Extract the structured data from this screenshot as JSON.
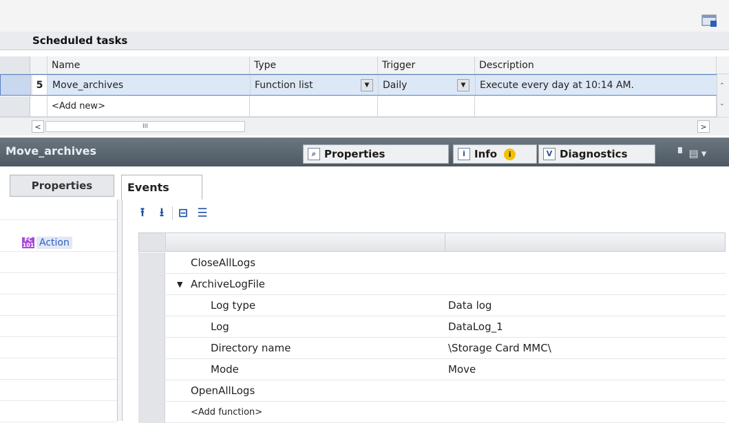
{
  "scheduled": {
    "title": "Scheduled tasks",
    "columns": [
      "Name",
      "Type",
      "Trigger",
      "Description"
    ],
    "task": {
      "number": "5",
      "name": "Move_archives",
      "type": "Function list",
      "trigger": "Daily",
      "description": "Execute every day at 10:14 AM."
    },
    "add_new": "<Add new>",
    "scroll_left": "<",
    "scroll_right": ">",
    "scroll_thumb": "III"
  },
  "inspector": {
    "object_title": "Move_archives",
    "tab_properties": "Properties",
    "tab_info": "Info",
    "tab_diagnostics": "Diagnostics"
  },
  "left_tabs": {
    "properties": "Properties",
    "events": "Events",
    "action": "Action"
  },
  "events": {
    "rows": [
      {
        "name": "CloseAllLogs",
        "value": ""
      },
      {
        "name": "ArchiveLogFile",
        "value": "",
        "expanded": true
      },
      {
        "name": "Log type",
        "value": "Data log"
      },
      {
        "name": "Log",
        "value": "DataLog_1"
      },
      {
        "name": "Directory name",
        "value": "\\Storage Card MMC\\"
      },
      {
        "name": "Mode",
        "value": "Move"
      },
      {
        "name": "OpenAllLogs",
        "value": ""
      },
      {
        "name": "<Add function>",
        "value": ""
      }
    ]
  }
}
